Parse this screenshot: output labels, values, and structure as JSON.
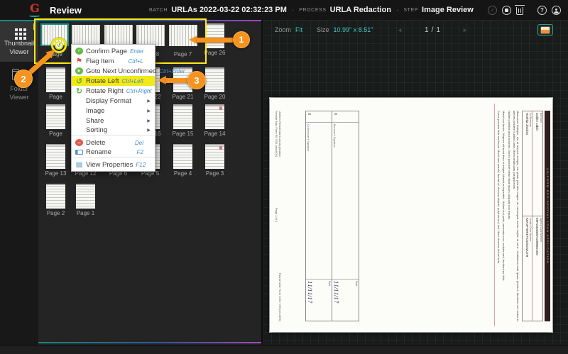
{
  "header": {
    "logo_letter": "G",
    "app_title": "Review",
    "batch_label": "BATCH",
    "batch_value": "URLAs 2022-03-22 02:32:23 PM",
    "dot": "·",
    "process_label": "PROCESS",
    "process_value": "URLA Redaction",
    "step_label": "STEP",
    "step_value": "Image Review"
  },
  "sidebar": {
    "thumbnail_viewer": "Thumbnail Viewer",
    "folder_viewer": "Folder Viewer"
  },
  "thumbnails": {
    "cells": [
      {
        "name": "thumbnail-selected",
        "label": "Page",
        "pos": "c1 r1 land sel"
      },
      {
        "name": "thumbnail",
        "label": "",
        "pos": "c2 r1 land"
      },
      {
        "name": "thumbnail",
        "label": "",
        "pos": "c3 r1 land"
      },
      {
        "name": "thumbnail-page-8",
        "label": "Page 8",
        "pos": "c4 r1 land"
      },
      {
        "name": "thumbnail-page-7",
        "label": "Page 7",
        "pos": "c5 r1 land"
      },
      {
        "name": "thumbnail-page-26",
        "label": "Page 26",
        "pos": "c6 r1"
      },
      {
        "name": "thumbnail",
        "label": "Page",
        "pos": "c1 r2"
      },
      {
        "name": "thumbnail",
        "label": "",
        "pos": "c2 r2"
      },
      {
        "name": "thumbnail",
        "label": "",
        "pos": "c3 r2"
      },
      {
        "name": "thumbnail-page-22",
        "label": "Page 22",
        "pos": "c4 r2"
      },
      {
        "name": "thumbnail-page-21",
        "label": "Page 21",
        "pos": "c5 r2"
      },
      {
        "name": "thumbnail-page-20",
        "label": "Page 20",
        "pos": "c6 r2"
      },
      {
        "name": "thumbnail",
        "label": "Page",
        "pos": "c1 r3"
      },
      {
        "name": "thumbnail",
        "label": "",
        "pos": "c2 r3"
      },
      {
        "name": "thumbnail",
        "label": "",
        "pos": "c3 r3"
      },
      {
        "name": "thumbnail-page-16",
        "label": "Page 16",
        "pos": "c4 r3"
      },
      {
        "name": "thumbnail-page-15",
        "label": "Page 15",
        "pos": "c5 r3"
      },
      {
        "name": "thumbnail-page-14",
        "label": "Page 14",
        "pos": "c6 r3 mark"
      },
      {
        "name": "thumbnail-page-13",
        "label": "Page 13",
        "pos": "c1 r4"
      },
      {
        "name": "thumbnail-page-12",
        "label": "Page 12",
        "pos": "c2 r4"
      },
      {
        "name": "thumbnail-page-6",
        "label": "Page 6",
        "pos": "c3 r4"
      },
      {
        "name": "thumbnail-page-5",
        "label": "Page 5",
        "pos": "c4 r4"
      },
      {
        "name": "thumbnail-page-4",
        "label": "Page 4",
        "pos": "c5 r4"
      },
      {
        "name": "thumbnail-page-3",
        "label": "Page 3",
        "pos": "c6 r4 mark"
      },
      {
        "name": "thumbnail-page-2",
        "label": "Page 2",
        "pos": "c1 r5"
      },
      {
        "name": "thumbnail-page-1",
        "label": "Page 1",
        "pos": "c2 r5"
      }
    ]
  },
  "menu": {
    "items": [
      {
        "name": "menu-item-confirm-page",
        "icon_name": "confirm-page-icon",
        "icon": "ic-confirm",
        "glyph": "✓",
        "label": "Confirm Page",
        "shortcut": "Enter"
      },
      {
        "name": "menu-item-flag-item",
        "icon_name": "flag-icon",
        "icon": "ic-flag",
        "glyph": "⚑",
        "label": "Flag Item",
        "shortcut": "Ctrl+L"
      },
      {
        "name": "menu-item-goto-next-unconfirmed",
        "icon_name": "goto-next-icon",
        "icon": "ic-goto",
        "glyph": "▶",
        "label": "Goto Next Unconfirmed",
        "shortcut": "Ctrl+Enter"
      },
      {
        "name": "menu-item-rotate-left",
        "icon_name": "rotate-left-icon",
        "icon": "ic-rotl",
        "glyph": "↺",
        "label": "Rotate Left",
        "shortcut": "Ctrl+Left",
        "cls": "hl"
      },
      {
        "name": "menu-item-rotate-right",
        "icon_name": "rotate-right-icon",
        "icon": "ic-rotr",
        "glyph": "↻",
        "label": "Rotate Right",
        "shortcut": "Ctrl+Right"
      },
      {
        "name": "menu-item-display-format",
        "label": "Display Format",
        "arrow": "▶"
      },
      {
        "name": "menu-item-image",
        "label": "Image",
        "arrow": "▶"
      },
      {
        "name": "menu-item-share",
        "label": "Share",
        "arrow": "▶"
      },
      {
        "name": "menu-item-sorting",
        "label": "Sorting",
        "arrow": "▶",
        "cls": "sep-after"
      },
      {
        "name": "menu-item-delete",
        "icon_name": "delete-icon",
        "icon": "ic-del",
        "glyph": "−",
        "label": "Delete",
        "shortcut": "Del"
      },
      {
        "name": "menu-item-rename",
        "icon_name": "rename-icon",
        "icon": "ic-rename",
        "glyph": "",
        "label": "Rename",
        "shortcut": "F2",
        "cls": "sep-after"
      },
      {
        "name": "menu-item-view-properties",
        "icon_name": "view-properties-icon",
        "icon": "ic-props",
        "glyph": "▤",
        "label": "View Properties",
        "shortcut": "F12"
      }
    ]
  },
  "preview": {
    "toolbar": {
      "zoom_label": "Zoom",
      "zoom_mode": "Fit",
      "size_label": "Size",
      "size_value": "10.99\" x 8.51\"",
      "prev": "◄",
      "next": "►",
      "page_current": "1",
      "page_divider": "/",
      "page_total": "1"
    },
    "document": {
      "header_bar": "UNIFORM RESIDENTIAL LOAN APPLICATION",
      "borrower_label": "Borrower",
      "borrower_name": "Cullen Labin",
      "coborrower_label": "Co-Borrower",
      "coborrower_name": "Hoshiw Jisshan",
      "agency_label": "Agency Case Number",
      "agency_value": "66F11B4G8V1O89BO1N0",
      "lender_label": "Lender Case Number",
      "lender_value": "K0A4FH09T7V2O8192UH9",
      "paragraphs": [
        {
          "text": "Maecenas tristique, est et tempus semper, est quam pharetra magna, ac consequat metus sapien ut nunc. Vestibulum ante ipsum primis in faucibus orci luctus et ultrices posuere cubilia Curae; Morbi vestibulum volutpat enim."
        },
        {
          "text": "Nullam porttitor lacus at turpis. Donec posuere metus vitae ipsum. Aliquam non mauris."
        },
        {
          "text": "Morbi non lectus. Aliquam sit amet diam in magna bibendum imperdiet. Nullam orci pede, venenatis non, sodales sed, tincidunt eu, felis."
        },
        {
          "text": "Fusce posuere felis sed lacus. Morbi sem mauris, laoreet ut, rhoncus aliquet, pulvinar sed, nisl. Nunc rhoncus dui vel sem."
        },
        {
          "text": "Sed sagittis. Nam congue, risus semper porta volutpat, quam pede lobortis ligula, sit amet eleifend pede libero quis orci. Nullam molestie nibh in lectus."
        }
      ],
      "signature_rows": [
        {
          "x": "X",
          "label": "Borrower's Signature",
          "date_label": "Date",
          "date": "11/11/17"
        },
        {
          "x": "X",
          "label": "Co-Borrower's Signature",
          "date_label": "Date",
          "date": "11/11/17"
        }
      ],
      "footer_left_1": "Uniform Residential Loan Application",
      "footer_left_2": "Freddie Mac Form 65   7/05 (rev.6/09)",
      "footer_center": "Page 1 of 1",
      "footer_right": "Fannie Mae Form 1003   7/05 (rev.6/09)"
    }
  },
  "callouts": {
    "one": "1",
    "two": "2",
    "three": "3"
  }
}
